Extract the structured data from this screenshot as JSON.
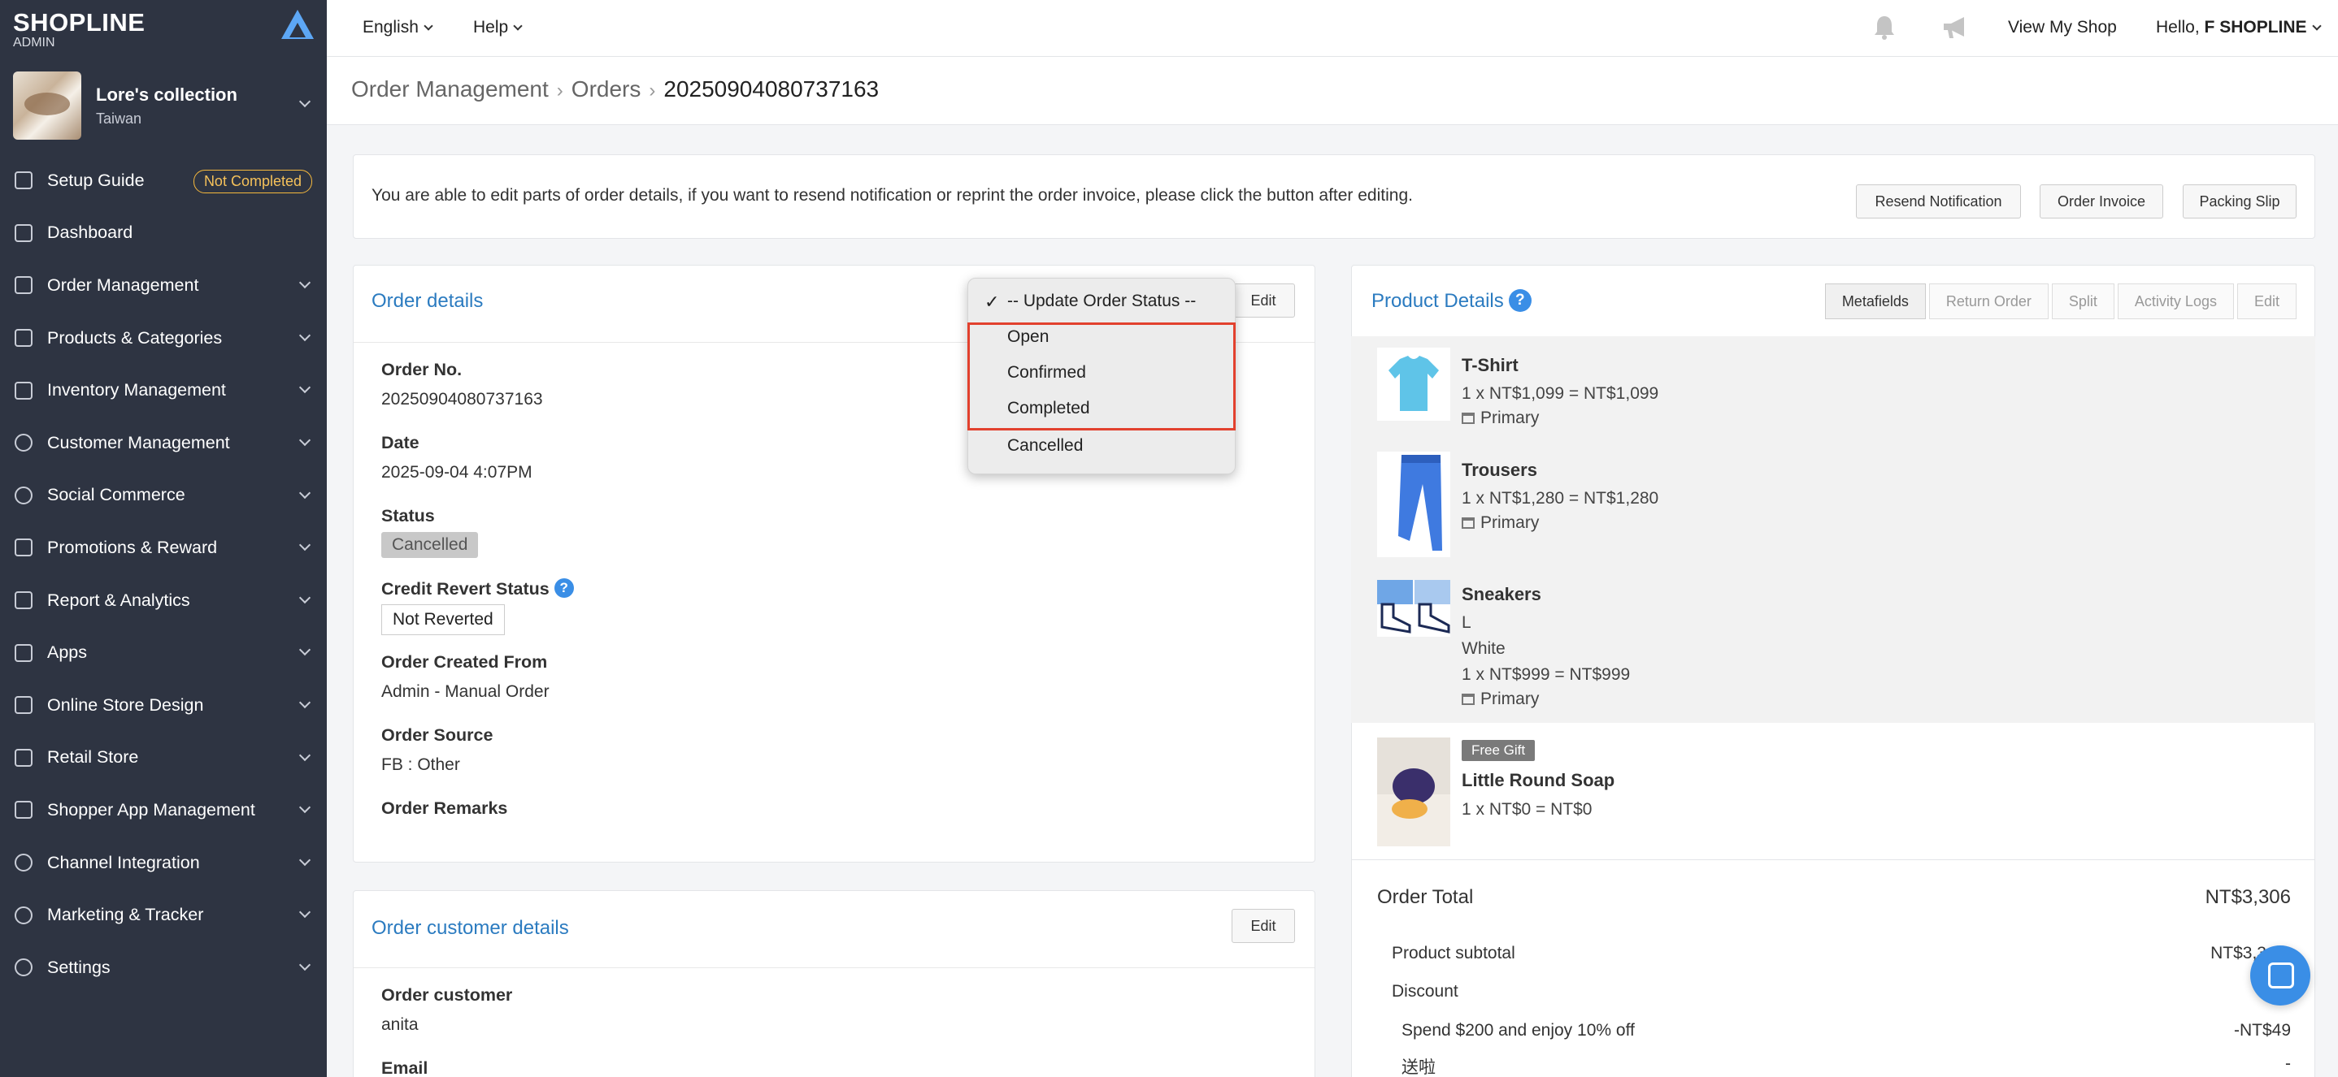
{
  "brand": {
    "name": "SHOPLINE",
    "sub": "ADMIN"
  },
  "store": {
    "name": "Lore's collection",
    "region": "Taiwan"
  },
  "sidebar": {
    "setup_guide": {
      "label": "Setup Guide",
      "badge": "Not Completed"
    },
    "items": [
      {
        "label": "Dashboard",
        "icon": "dashboard-icon"
      },
      {
        "label": "Order Management",
        "icon": "order-icon"
      },
      {
        "label": "Products & Categories",
        "icon": "bag-icon"
      },
      {
        "label": "Inventory Management",
        "icon": "inventory-icon"
      },
      {
        "label": "Customer Management",
        "icon": "user-icon"
      },
      {
        "label": "Social Commerce",
        "icon": "chat-icon"
      },
      {
        "label": "Promotions & Reward",
        "icon": "tag-icon"
      },
      {
        "label": "Report & Analytics",
        "icon": "chart-icon"
      },
      {
        "label": "Apps",
        "icon": "apps-icon"
      },
      {
        "label": "Online Store Design",
        "icon": "paint-icon"
      },
      {
        "label": "Retail Store",
        "icon": "store-icon"
      },
      {
        "label": "Shopper App Management",
        "icon": "shopping-bag-icon"
      },
      {
        "label": "Channel Integration",
        "icon": "globe-icon"
      },
      {
        "label": "Marketing & Tracker",
        "icon": "target-icon"
      },
      {
        "label": "Settings",
        "icon": "gear-icon"
      }
    ]
  },
  "topbar": {
    "language": "English",
    "help": "Help",
    "view_shop": "View My Shop",
    "greeting": "Hello, ",
    "user": "F SHOPLINE"
  },
  "breadcrumb": {
    "level1": "Order Management",
    "level2": "Orders",
    "current": "20250904080737163"
  },
  "notice": {
    "text": "You are able to edit parts of order details, if you want to resend notification or reprint the order invoice, please click the button after editing.",
    "buttons": [
      "Resend Notification",
      "Order Invoice",
      "Packing Slip"
    ]
  },
  "order_details": {
    "title": "Order details",
    "edit": "Edit",
    "order_no_label": "Order No.",
    "order_no": "20250904080737163",
    "date_label": "Date",
    "date": "2025-09-04 4:07PM",
    "status_label": "Status",
    "status": "Cancelled",
    "credit_label": "Credit Revert Status",
    "credit_value": "Not Reverted",
    "created_from_label": "Order Created From",
    "created_from": "Admin - Manual Order",
    "source_label": "Order Source",
    "source": "FB : Other",
    "remarks_label": "Order Remarks"
  },
  "status_dropdown": {
    "selected": "-- Update Order Status --",
    "options": [
      "Open",
      "Confirmed",
      "Completed",
      "Cancelled"
    ]
  },
  "customer_details": {
    "title": "Order customer details",
    "edit": "Edit",
    "customer_label": "Order customer",
    "customer": "anita",
    "email_label": "Email"
  },
  "product_details": {
    "title": "Product Details",
    "tabs": [
      "Metafields",
      "Return Order",
      "Split",
      "Activity Logs",
      "Edit"
    ],
    "products": [
      {
        "name": "T-Shirt",
        "price_line": "1 x NT$1,099 = NT$1,099",
        "location": "Primary"
      },
      {
        "name": "Trousers",
        "price_line": "1 x NT$1,280 = NT$1,280",
        "location": "Primary"
      },
      {
        "name": "Sneakers",
        "size": "L",
        "color": "White",
        "price_line": "1 x NT$999 = NT$999",
        "location": "Primary"
      }
    ],
    "gift": {
      "badge": "Free Gift",
      "name": "Little Round Soap",
      "price_line": "1 x NT$0 = NT$0"
    }
  },
  "totals": {
    "order_total_label": "Order Total",
    "order_total": "NT$3,306",
    "subtotal_label": "Product subtotal",
    "subtotal": "NT$3,3",
    "discount_label": "Discount",
    "promo_label": "Spend $200 and enjoy 10% off",
    "promo_value": "-NT$49",
    "gift_label": "送啦",
    "gift_value": "-"
  }
}
